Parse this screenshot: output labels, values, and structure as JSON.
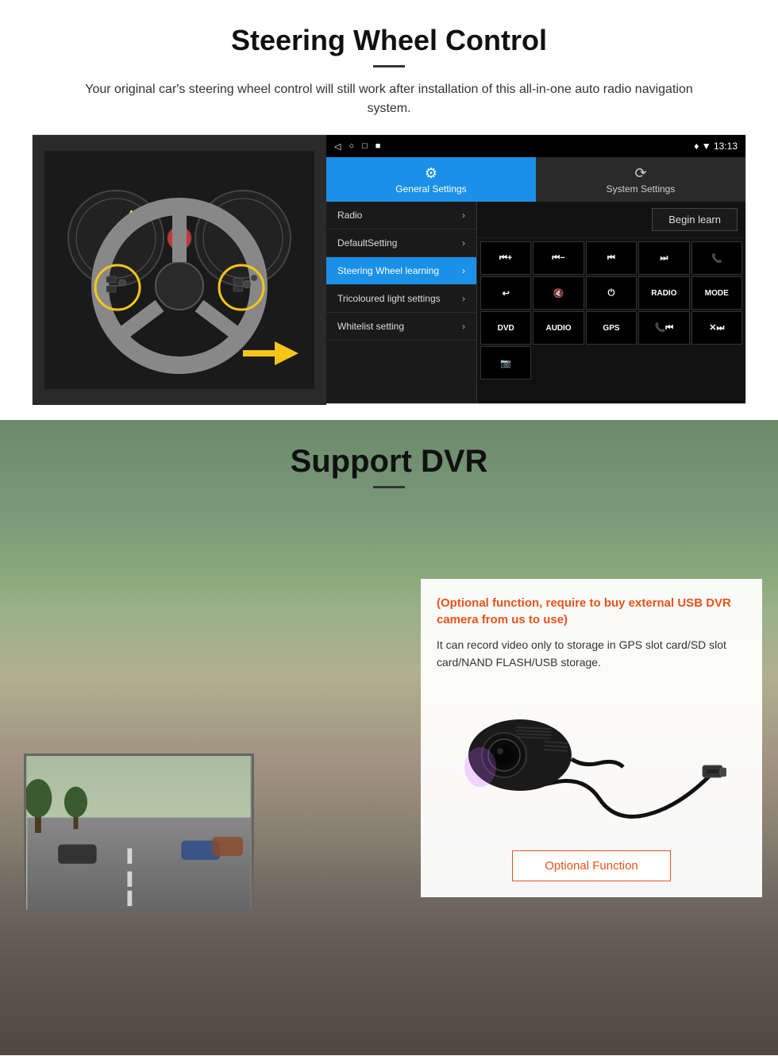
{
  "steering_section": {
    "title": "Steering Wheel Control",
    "subtitle": "Your original car's steering wheel control will still work after installation of this all-in-one auto radio navigation system.",
    "status_bar": {
      "nav_icons": [
        "◁",
        "○",
        "□",
        "■"
      ],
      "time": "13:13",
      "signal": "▼"
    },
    "tabs": {
      "general": {
        "label": "General Settings",
        "icon": "⚙"
      },
      "system": {
        "label": "System Settings",
        "icon": "🔄"
      }
    },
    "menu_items": [
      {
        "label": "Radio",
        "active": false
      },
      {
        "label": "DefaultSetting",
        "active": false
      },
      {
        "label": "Steering Wheel learning",
        "active": true
      },
      {
        "label": "Tricoloured light settings",
        "active": false
      },
      {
        "label": "Whitelist setting",
        "active": false
      }
    ],
    "begin_learn": "Begin learn",
    "control_buttons": [
      "⏮+",
      "⏮-",
      "⏮",
      "⏭",
      "📞",
      "↩",
      "🔇×",
      "⏻",
      "RADIO",
      "MODE",
      "DVD",
      "AUDIO",
      "GPS",
      "📞⏮",
      "×⏭"
    ],
    "extra_button": "📱"
  },
  "dvr_section": {
    "title": "Support DVR",
    "optional_text": "(Optional function, require to buy external USB DVR camera from us to use)",
    "description": "It can record video only to storage in GPS slot card/SD slot card/NAND FLASH/USB storage.",
    "optional_function_label": "Optional Function"
  }
}
